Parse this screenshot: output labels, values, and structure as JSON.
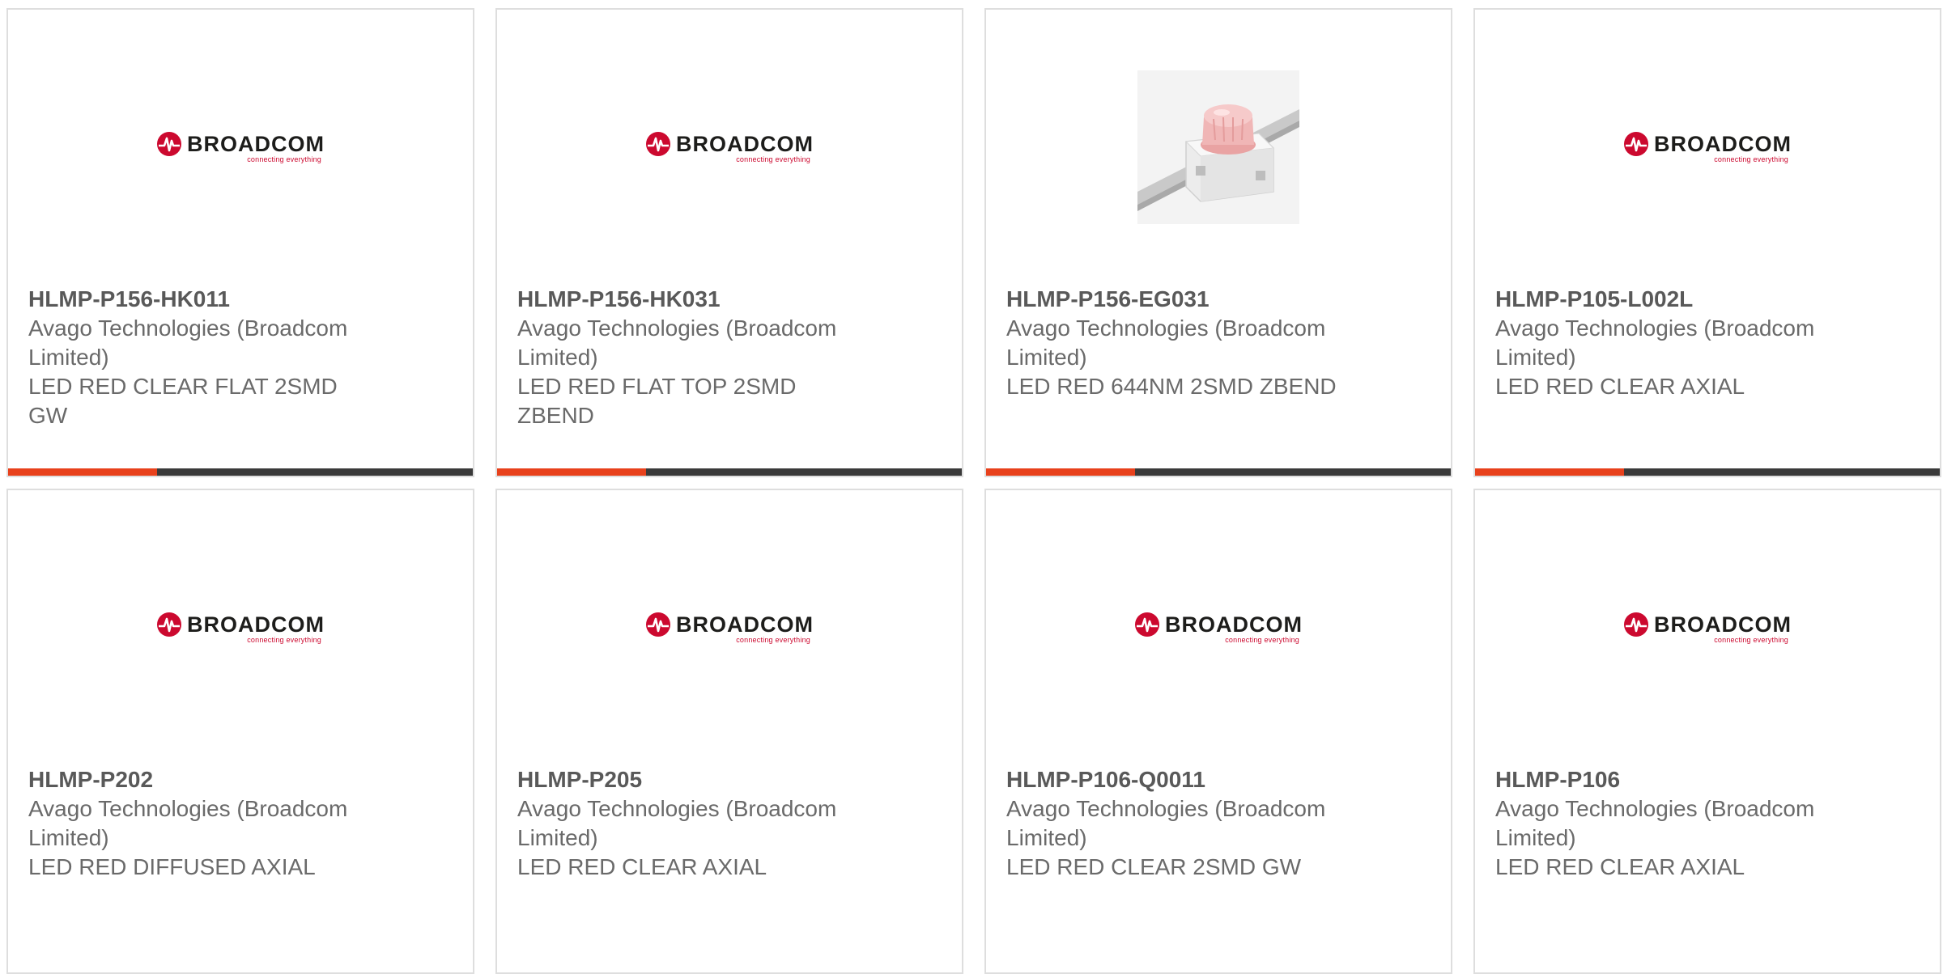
{
  "brand_colors": {
    "accent_bar": "#e8411c",
    "bar_track": "#3a3a3a",
    "broadcom_red": "#cc092f"
  },
  "logo": {
    "wordmark": "BROADCOM",
    "tagline": "connecting everything",
    "mark_icon": "broadcom-pulse-icon"
  },
  "products": [
    {
      "part_number": "HLMP-P156-HK011",
      "manufacturer": "Avago Technologies (Broadcom Limited)",
      "description": "LED RED CLEAR FLAT 2SMD GW",
      "image": "broadcom-logo",
      "bar_fill": 0.32
    },
    {
      "part_number": "HLMP-P156-HK031",
      "manufacturer": "Avago Technologies (Broadcom Limited)",
      "description": "LED RED FLAT TOP 2SMD ZBEND",
      "image": "broadcom-logo",
      "bar_fill": 0.32
    },
    {
      "part_number": "HLMP-P156-EG031",
      "manufacturer": "Avago Technologies (Broadcom Limited)",
      "description": "LED RED 644NM 2SMD ZBEND",
      "image": "led-photo",
      "bar_fill": 0.32
    },
    {
      "part_number": "HLMP-P105-L002L",
      "manufacturer": "Avago Technologies (Broadcom Limited)",
      "description": "LED RED CLEAR AXIAL",
      "image": "broadcom-logo",
      "bar_fill": 0.32
    },
    {
      "part_number": "HLMP-P202",
      "manufacturer": "Avago Technologies (Broadcom Limited)",
      "description": "LED RED DIFFUSED AXIAL",
      "image": "broadcom-logo"
    },
    {
      "part_number": "HLMP-P205",
      "manufacturer": "Avago Technologies (Broadcom Limited)",
      "description": "LED RED CLEAR AXIAL",
      "image": "broadcom-logo"
    },
    {
      "part_number": "HLMP-P106-Q0011",
      "manufacturer": "Avago Technologies (Broadcom Limited)",
      "description": "LED RED CLEAR 2SMD GW",
      "image": "broadcom-logo"
    },
    {
      "part_number": "HLMP-P106",
      "manufacturer": "Avago Technologies (Broadcom Limited)",
      "description": "LED RED CLEAR AXIAL",
      "image": "broadcom-logo"
    }
  ]
}
